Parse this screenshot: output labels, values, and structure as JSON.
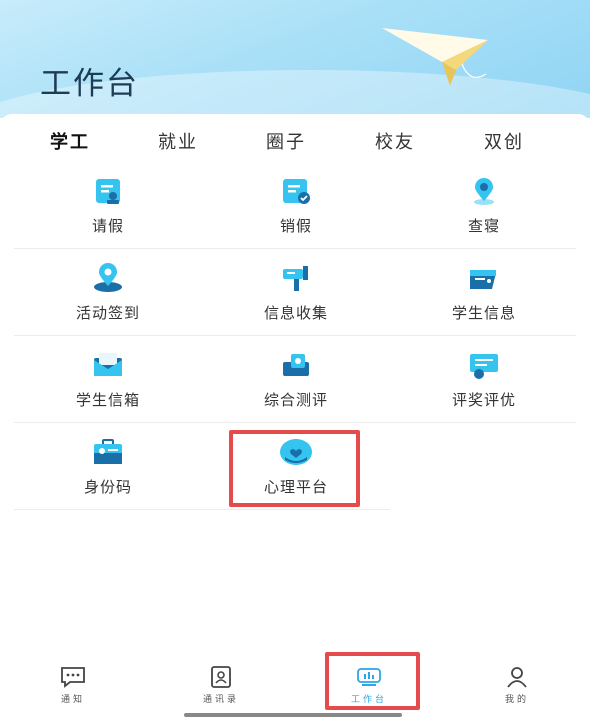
{
  "header": {
    "title": "工作台"
  },
  "tabs": [
    {
      "label": "学工",
      "active": true
    },
    {
      "label": "就业"
    },
    {
      "label": "圈子"
    },
    {
      "label": "校友"
    },
    {
      "label": "双创"
    }
  ],
  "grid": {
    "items": [
      {
        "label": "请假",
        "icon": "leave-request-icon"
      },
      {
        "label": "销假",
        "icon": "leave-cancel-icon"
      },
      {
        "label": "查寝",
        "icon": "dorm-check-icon"
      },
      {
        "label": "活动签到",
        "icon": "activity-checkin-icon"
      },
      {
        "label": "信息收集",
        "icon": "info-collection-icon"
      },
      {
        "label": "学生信息",
        "icon": "student-info-icon"
      },
      {
        "label": "学生信箱",
        "icon": "student-mailbox-icon"
      },
      {
        "label": "综合测评",
        "icon": "comprehensive-eval-icon"
      },
      {
        "label": "评奖评优",
        "icon": "award-icon"
      },
      {
        "label": "身份码",
        "icon": "id-code-icon"
      },
      {
        "label": "心理平台",
        "icon": "psychology-icon"
      }
    ]
  },
  "bottom_nav": [
    {
      "label": "通知",
      "icon": "message-icon"
    },
    {
      "label": "通讯录",
      "icon": "contacts-icon"
    },
    {
      "label": "工作台",
      "icon": "workbench-icon",
      "active": true
    },
    {
      "label": "我的",
      "icon": "profile-icon"
    }
  ],
  "colors": {
    "accent": "#2aa7e8",
    "icon_dark": "#1a6fa8",
    "icon_light": "#35c3f0",
    "highlight": "#e54b4b"
  }
}
